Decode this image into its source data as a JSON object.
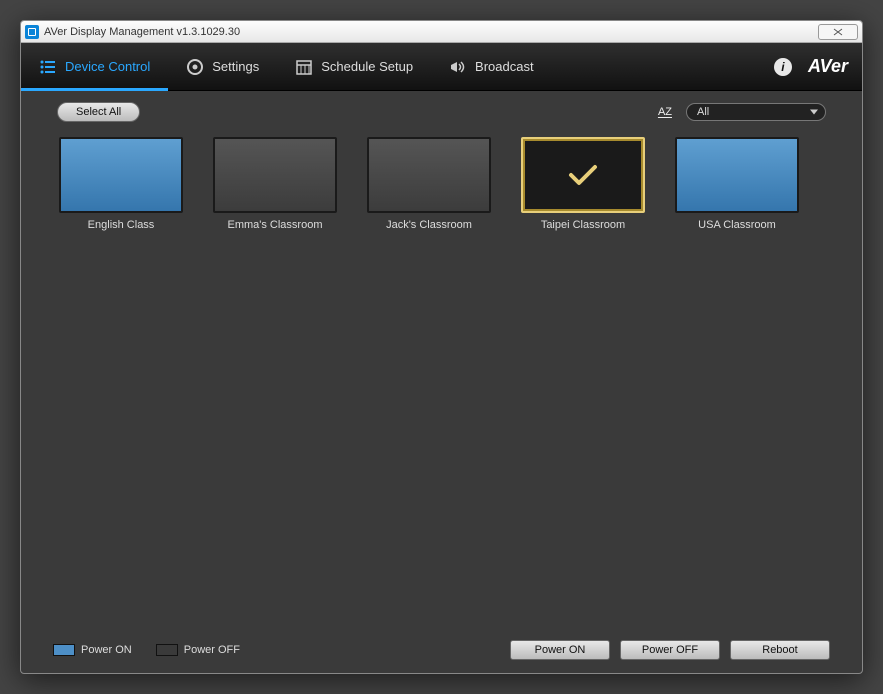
{
  "window": {
    "title": "AVer Display Management v1.3.1029.30"
  },
  "nav": {
    "tabs": [
      {
        "label": "Device Control",
        "active": true
      },
      {
        "label": "Settings"
      },
      {
        "label": "Schedule Setup"
      },
      {
        "label": "Broadcast"
      }
    ],
    "brand": "AVer"
  },
  "toolbar": {
    "select_all": "Select All",
    "sort": "AZ",
    "filter_selected": "All"
  },
  "devices": [
    {
      "name": "English Class",
      "state": "on",
      "selected": false
    },
    {
      "name": "Emma's Classroom",
      "state": "off",
      "selected": false
    },
    {
      "name": "Jack's Classroom",
      "state": "off",
      "selected": false
    },
    {
      "name": "Taipei Classroom",
      "state": "on",
      "selected": true
    },
    {
      "name": "USA Classroom",
      "state": "on",
      "selected": false
    }
  ],
  "legend": {
    "on": "Power ON",
    "off": "Power OFF"
  },
  "footer_buttons": {
    "power_on": "Power ON",
    "power_off": "Power OFF",
    "reboot": "Reboot"
  }
}
